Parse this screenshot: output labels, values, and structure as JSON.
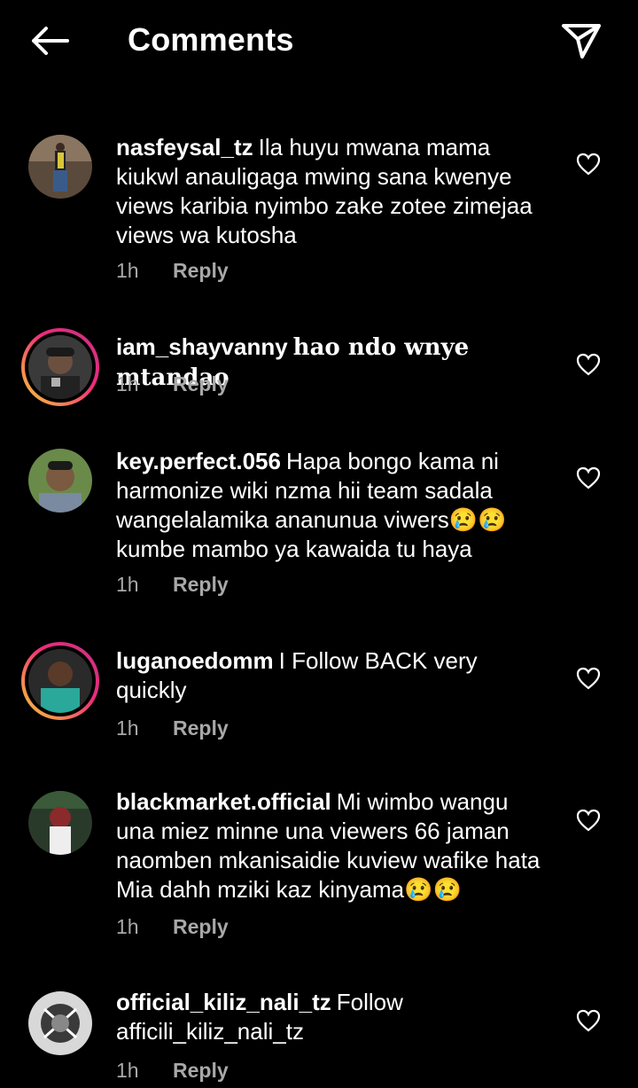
{
  "header": {
    "title": "Comments",
    "back_icon": "arrow-left-icon",
    "share_icon": "paper-plane-icon"
  },
  "comments": [
    {
      "username": "nasfeysal_tz",
      "text": "Ila huyu mwana mama kiukwl anauligaga mwing sana kwenye views karibia nyimbo zake zotee zimejaa views wa kutosha",
      "time": "1h",
      "reply": "Reply"
    },
    {
      "username": "iam_shayvanny",
      "text": "hao ndo wnye mtandao",
      "time": "1h",
      "reply": "Reply"
    },
    {
      "username": "key.perfect.056",
      "text": "Hapa bongo kama ni harmonize wiki nzma hii team sadala wangelalamika ananunua viwers😢😢 kumbe mambo ya kawaida tu haya",
      "time": "1h",
      "reply": "Reply"
    },
    {
      "username": "luganoedomm",
      "text": "I Follow BACK very quickly",
      "time": "1h",
      "reply": "Reply"
    },
    {
      "username": "blackmarket.official",
      "text": "Mi wimbo wangu una miez minne una viewers 66 jaman naomben mkanisaidie kuview wafike hata Mia dahh mziki kaz kinyama😢😢",
      "time": "1h",
      "reply": "Reply"
    },
    {
      "username": "official_kiliz_nali_tz",
      "text": "Follow afficili_kiliz_nali_tz",
      "time": "1h",
      "reply": "Reply"
    }
  ],
  "colors": {
    "background": "#000000",
    "text": "#ffffff",
    "meta": "#a8a8a8",
    "story_ring_start": "#f9ce34",
    "story_ring_end": "#c13584"
  }
}
